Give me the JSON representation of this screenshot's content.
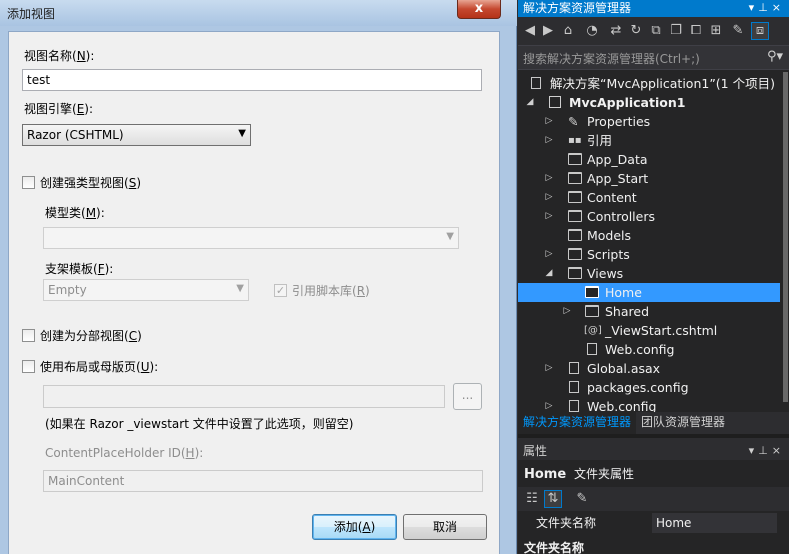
{
  "dialog": {
    "title": "添加视图",
    "close_label": "x",
    "view_name_label": "视图名称(",
    "view_name_key": "N",
    "view_name_value": "test",
    "view_engine_label": "视图引擎(",
    "view_engine_key": "E",
    "view_engine_value": "Razor (CSHTML)",
    "strong_typed_label": "创建强类型视图(",
    "strong_typed_key": "S",
    "model_class_label": "模型类(",
    "model_class_key": "M",
    "scaffold_label": "支架模板(",
    "scaffold_key": "F",
    "scaffold_value": "Empty",
    "ref_scripts_label": "引用脚本库(",
    "ref_scripts_key": "R",
    "partial_label": "创建为分部视图(",
    "partial_key": "C",
    "layout_label": "使用布局或母版页(",
    "layout_key": "U",
    "browse_label": "...",
    "layout_hint": "(如果在 Razor _viewstart 文件中设置了此选项，则留空)",
    "cph_label": "ContentPlaceHolder ID(",
    "cph_key": "H",
    "cph_value": "MainContent",
    "add_label": "添加(",
    "add_key": "A",
    "cancel_label": "取消",
    "close_paren": ")",
    "close_paren_colon": "):"
  },
  "solution_explorer": {
    "title": "解决方案资源管理器",
    "search_placeholder": "搜索解决方案资源管理器(Ctrl+;)",
    "tree": [
      {
        "label": "解决方案“MvcApplication1”(1 个项目)"
      },
      {
        "label": "MvcApplication1"
      },
      {
        "label": "Properties"
      },
      {
        "label": "引用"
      },
      {
        "label": "App_Data"
      },
      {
        "label": "App_Start"
      },
      {
        "label": "Content"
      },
      {
        "label": "Controllers"
      },
      {
        "label": "Models"
      },
      {
        "label": "Scripts"
      },
      {
        "label": "Views"
      },
      {
        "label": "Home"
      },
      {
        "label": "Shared"
      },
      {
        "label": "_ViewStart.cshtml"
      },
      {
        "label": "Web.config"
      },
      {
        "label": "Global.asax"
      },
      {
        "label": "packages.config"
      },
      {
        "label": "Web.config"
      }
    ],
    "tabs": [
      "解决方案资源管理器",
      "团队资源管理器"
    ],
    "selected_item": "Home"
  },
  "properties": {
    "title": "属性",
    "object_name": "Home",
    "object_type": "文件夹属性",
    "row_key": "文件夹名称",
    "row_value": "Home",
    "description_title": "文件夹名称"
  },
  "colors": {
    "accent": "#007acc",
    "selection": "#3399ff",
    "dark_bg": "#252526"
  }
}
